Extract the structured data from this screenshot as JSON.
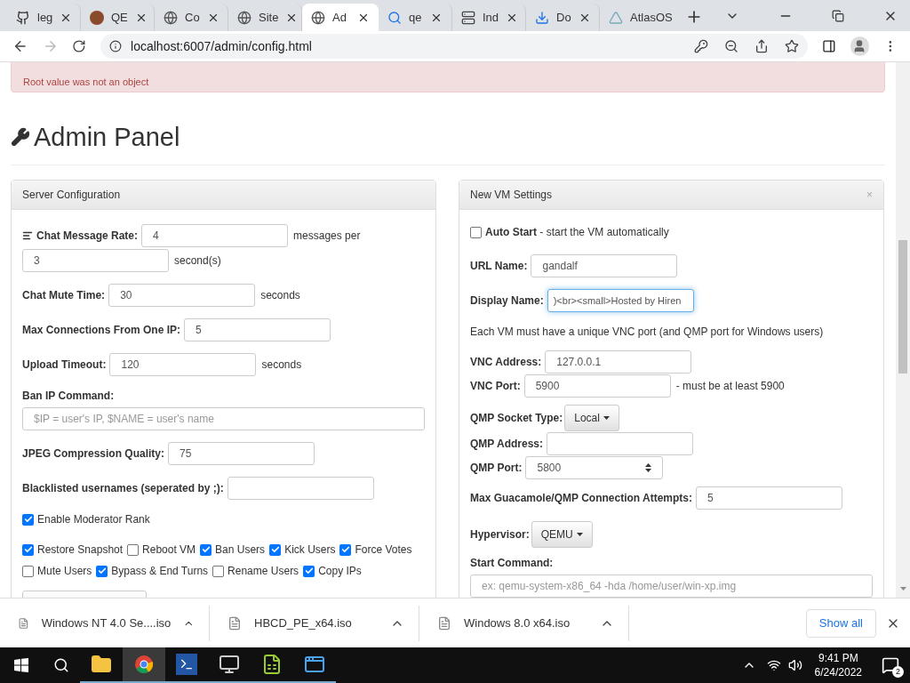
{
  "tabs": [
    {
      "label": "leg",
      "selected": false
    },
    {
      "label": "QE",
      "selected": false
    },
    {
      "label": "Co",
      "selected": false
    },
    {
      "label": "Site",
      "selected": false
    },
    {
      "label": "Ad",
      "selected": true
    },
    {
      "label": "qe",
      "selected": false
    },
    {
      "label": "Ind",
      "selected": false
    },
    {
      "label": "Do",
      "selected": false
    },
    {
      "label": "AtlasOS",
      "selected": false
    }
  ],
  "address": "localhost:6007/admin/config.html",
  "alert": {
    "message": "Root value was not an object"
  },
  "heading": "Admin Panel",
  "left_panel": {
    "title": "Server Configuration",
    "items": [
      {
        "kind": "rate",
        "label": "Chat Message Rate:",
        "value": "4",
        "middle": "messages per",
        "value2": "3",
        "suffix": "second(s)"
      },
      {
        "kind": "field",
        "label": "Chat Mute Time:",
        "value": "30",
        "suffix": "seconds"
      },
      {
        "kind": "field",
        "label": "Max Connections From One IP:",
        "value": "5"
      },
      {
        "kind": "field",
        "label": "Upload Timeout:",
        "value": "120",
        "suffix": "seconds"
      },
      {
        "kind": "wide_field",
        "label": "Ban IP Command:",
        "placeholder": "$IP = user's IP, $NAME = user's name"
      },
      {
        "kind": "field",
        "label": "JPEG Compression Quality:",
        "value": "75"
      },
      {
        "kind": "field",
        "label": "Blacklisted usernames (seperated by ;):"
      },
      {
        "kind": "checkbox",
        "label": "Enable Moderator Rank",
        "checked": true
      },
      {
        "kind": "checkgroup",
        "items": [
          {
            "label": "Restore Snapshot",
            "checked": true
          },
          {
            "label": "Reboot VM",
            "checked": false
          },
          {
            "label": "Ban Users",
            "checked": true
          },
          {
            "label": "Kick Users",
            "checked": true
          },
          {
            "label": "Force Votes",
            "checked": true
          },
          {
            "label": "Mute Users",
            "checked": false
          },
          {
            "label": "Bypass & End Turns",
            "checked": true
          },
          {
            "label": "Rename Users",
            "checked": false
          },
          {
            "label": "Copy IPs",
            "checked": true
          }
        ]
      },
      {
        "kind": "save_button"
      }
    ]
  },
  "right_panel": {
    "title": "New VM Settings",
    "close": "×",
    "items": [
      {
        "kind": "checkbox",
        "label": "Auto Start",
        "note": " - start the VM automatically",
        "checked": false
      },
      {
        "kind": "field",
        "label": "URL Name:",
        "value": "gandalf"
      },
      {
        "kind": "field",
        "label": "Display Name:",
        "value": ")<br><small>Hosted by Hiren",
        "focused": true
      },
      {
        "kind": "text",
        "text": "Each VM must have a unique VNC port (and QMP port for Windows users)"
      },
      {
        "kind": "group",
        "fields": [
          {
            "kind": "field",
            "label": "VNC Address:",
            "value": "127.0.0.1"
          },
          {
            "kind": "field",
            "label": "VNC Port:",
            "value": "5900",
            "suffix": "- must be at least 5900"
          }
        ]
      },
      {
        "kind": "group",
        "fields": [
          {
            "kind": "dropdown",
            "label": "QMP Socket Type:",
            "value": "Local"
          },
          {
            "kind": "field",
            "label": "QMP Address:"
          },
          {
            "kind": "spinner",
            "label": "QMP Port:",
            "value": "5800"
          }
        ]
      },
      {
        "kind": "field",
        "label": "Max Guacamole/QMP Connection Attempts:",
        "value": "5"
      },
      {
        "kind": "dropdown",
        "label": "Hypervisor:",
        "value": "QEMU"
      },
      {
        "kind": "wide_field",
        "label": "Start Command:",
        "placeholder": "ex: qemu-system-x86_64 -hda /home/user/win-xp.img"
      }
    ]
  },
  "downloads": [
    {
      "name": "Windows NT 4.0 Se....iso"
    },
    {
      "name": "HBCD_PE_x64.iso"
    },
    {
      "name": "Windows 8.0 x64.iso"
    }
  ],
  "show_all": "Show all",
  "taskbar": {
    "apps": [
      {
        "selected": false
      },
      {
        "selected": true
      },
      {
        "selected": false
      },
      {
        "selected": false
      },
      {
        "selected": false
      },
      {
        "selected": false
      }
    ],
    "time": "9:41 PM",
    "date": "6/24/2022",
    "notifications": "2"
  }
}
